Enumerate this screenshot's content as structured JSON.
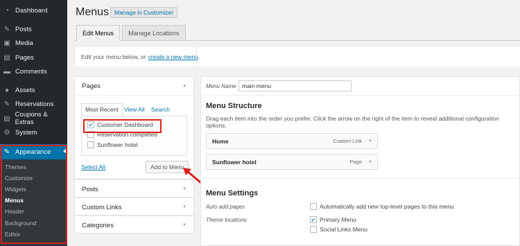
{
  "sidebar": {
    "items": [
      {
        "label": "Dashboard",
        "icon": "dashboard-icon",
        "glyph": "◔"
      },
      {
        "label": "Posts",
        "icon": "pin-icon",
        "glyph": "✎"
      },
      {
        "label": "Media",
        "icon": "media-icon",
        "glyph": "▣"
      },
      {
        "label": "Pages",
        "icon": "pages-icon",
        "glyph": "▤"
      },
      {
        "label": "Comments",
        "icon": "comments-icon",
        "glyph": "▬"
      },
      {
        "label": "Assets",
        "icon": "assets-icon",
        "glyph": "●"
      },
      {
        "label": "Reservations",
        "icon": "reservations-icon",
        "glyph": "✎"
      },
      {
        "label": "Coupons & Extras",
        "icon": "coupons-icon",
        "glyph": "▤"
      },
      {
        "label": "System",
        "icon": "system-icon",
        "glyph": "⚙"
      },
      {
        "label": "Appearance",
        "icon": "appearance-icon",
        "glyph": "✎"
      }
    ],
    "submenu": [
      "Themes",
      "Customize",
      "Widgets",
      "Menus",
      "Header",
      "Background",
      "Editor"
    ],
    "active_bg": "#0073aa",
    "highlight": "#d9231a"
  },
  "header": {
    "title": "Menus",
    "customizer_label": "Manage in Customizer",
    "tabs": [
      "Edit Menus",
      "Manage Locations"
    ]
  },
  "notice": {
    "text": "Edit your menu below, or",
    "link": "create a new menu",
    "period": "."
  },
  "pages_panel": {
    "title": "Pages",
    "tabs": [
      "Most Recent",
      "View All",
      "Search"
    ],
    "items": [
      {
        "label": "Customer Dashboard",
        "checked": true
      },
      {
        "label": "Reservation completed",
        "checked": false
      },
      {
        "label": "Sunflower hotel",
        "checked": false
      }
    ],
    "select_all": "Select All",
    "add_button": "Add to Menu"
  },
  "accordions": [
    "Posts",
    "Custom Links",
    "Categories"
  ],
  "menu": {
    "name_label": "Menu Name",
    "name_value": "main menu",
    "structure_title": "Menu Structure",
    "structure_desc": "Drag each item into the order you prefer. Click the arrow on the right of the item to reveal additional configuration options.",
    "items": [
      {
        "label": "Home",
        "type": "Custom Link"
      },
      {
        "label": "Sunflower hotel",
        "type": "Page"
      }
    ],
    "settings_title": "Menu Settings",
    "auto_add_label": "Auto add pages",
    "auto_add_option": "Automatically add new top-level pages to this menu",
    "locations_label": "Theme locations",
    "locations": [
      {
        "label": "Primary Menu",
        "checked": true
      },
      {
        "label": "Social Links Menu",
        "checked": false
      }
    ]
  }
}
